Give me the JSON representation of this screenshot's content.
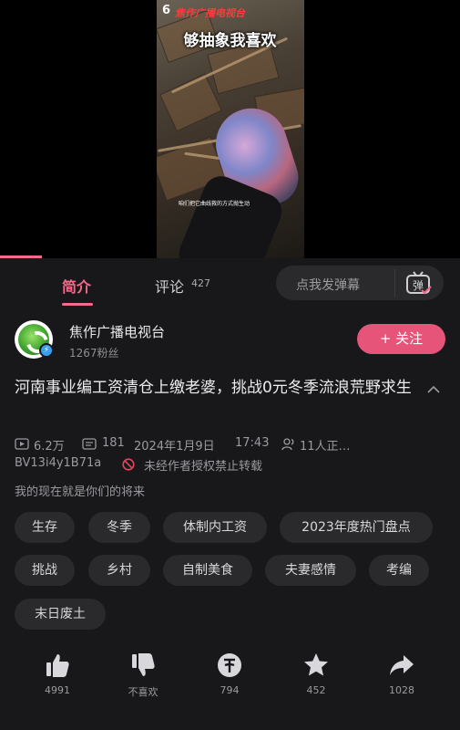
{
  "video": {
    "channel_number": "6",
    "channel_logo": "焦作广播电视台",
    "caption": "够抽象我喜欢",
    "subtitle": "咱们把它曲线救的方式抛生动"
  },
  "tabs": {
    "intro": "简介",
    "comments": "评论",
    "comments_count": "427",
    "danmaku_placeholder": "点我发弹幕",
    "danmaku_icon_glyph": "弹"
  },
  "author": {
    "name": "焦作广播电视台",
    "fans": "1267粉丝",
    "follow_label": "+ 关注"
  },
  "title": "河南事业编工资清仓上缴老婆，挑战0元冬季流浪荒野求生",
  "stats": {
    "views": "6.2万",
    "danmaku": "181",
    "date": "2024年1月9日",
    "time": "17:43",
    "watching": "11人正…",
    "bvid": "BV13i4y1B71a",
    "notice": "未经作者授权禁止转载"
  },
  "description": "我的现在就是你们的将来",
  "tags": [
    "生存",
    "冬季",
    "体制内工资",
    "2023年度热门盘点",
    "挑战",
    "乡村",
    "自制美食",
    "夫妻感情",
    "考编",
    "末日废土"
  ],
  "actions": {
    "like": "4991",
    "dislike": "不喜欢",
    "coin": "794",
    "favorite": "452",
    "share": "1028"
  },
  "colors": {
    "accent": "#f26b8a",
    "follow_bg": "#e6547a",
    "background": "#18181a"
  }
}
